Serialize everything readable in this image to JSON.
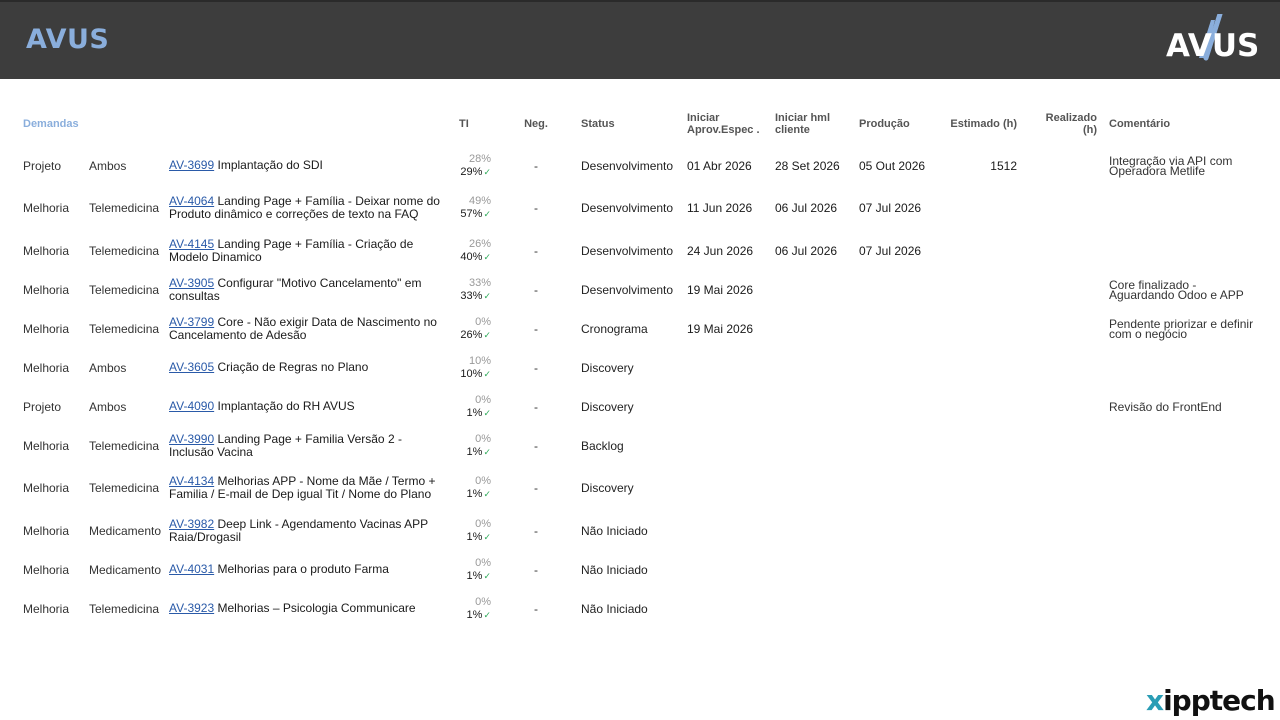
{
  "header": {
    "title": "AVUS",
    "title_color": "#8aaedc",
    "background": "#3d3d3d",
    "logo_text": "AVUS"
  },
  "columns": {
    "demandas": "Demandas",
    "ti": "TI",
    "neg": "Neg.",
    "status": "Status",
    "iniciar_aprov": "Iniciar Aprov.Espec .",
    "iniciar_hml": "Iniciar  hml cliente",
    "producao": "Produção",
    "estimado": "Estimado (h)",
    "realizado": "Realizado (h)",
    "comentario": "Comentário"
  },
  "rows": [
    {
      "tipo": "Projeto",
      "area": "Ambos",
      "code": "AV-3699",
      "title": "Implantação do SDI",
      "ti_est": "28%",
      "ti_real": "29%",
      "neg": "-",
      "status": "Desenvolvimento",
      "aprov": "01 Abr 2026",
      "hml": "28 Set 2026",
      "prod": "05 Out 2026",
      "estimado": "1512",
      "realizado": "",
      "comentario": "Integração via API com Operadora Metlife"
    },
    {
      "tipo": "Melhoria",
      "area": "Telemedicina",
      "code": "AV-4064",
      "title": "Landing Page + Família - Deixar nome do Produto dinâmico e correções de texto na FAQ",
      "ti_est": "49%",
      "ti_real": "57%",
      "neg": "-",
      "status": "Desenvolvimento",
      "aprov": "11 Jun 2026",
      "hml": "06 Jul 2026",
      "prod": "07 Jul 2026",
      "estimado": "",
      "realizado": "",
      "comentario": ""
    },
    {
      "tipo": "Melhoria",
      "area": "Telemedicina",
      "code": "AV-4145",
      "title": "Landing Page + Família - Criação de Modelo Dinamico",
      "ti_est": "26%",
      "ti_real": "40%",
      "neg": "-",
      "status": "Desenvolvimento",
      "aprov": "24 Jun 2026",
      "hml": "06 Jul 2026",
      "prod": "07 Jul 2026",
      "estimado": "",
      "realizado": "",
      "comentario": ""
    },
    {
      "tipo": "Melhoria",
      "area": "Telemedicina",
      "code": "AV-3905",
      "title": "Configurar \"Motivo Cancelamento\" em consultas",
      "ti_est": "33%",
      "ti_real": "33%",
      "neg": "-",
      "status": "Desenvolvimento",
      "aprov": "19 Mai 2026",
      "hml": "",
      "prod": "",
      "estimado": "",
      "realizado": "",
      "comentario": "Core finalizado - Aguardando Odoo e APP"
    },
    {
      "tipo": "Melhoria",
      "area": "Telemedicina",
      "code": "AV-3799",
      "title": "Core - Não exigir Data de Nascimento no Cancelamento de Adesão",
      "ti_est": "0%",
      "ti_real": "26%",
      "neg": "-",
      "status": "Cronograma",
      "aprov": "19 Mai 2026",
      "hml": "",
      "prod": "",
      "estimado": "",
      "realizado": "",
      "comentario": "Pendente priorizar e definir com o negócio"
    },
    {
      "tipo": "Melhoria",
      "area": "Ambos",
      "code": "AV-3605",
      "title": "Criação de Regras no Plano",
      "ti_est": "10%",
      "ti_real": "10%",
      "neg": "-",
      "status": "Discovery",
      "aprov": "",
      "hml": "",
      "prod": "",
      "estimado": "",
      "realizado": "",
      "comentario": ""
    },
    {
      "tipo": "Projeto",
      "area": "Ambos",
      "code": "AV-4090",
      "title": "Implantação do RH AVUS",
      "ti_est": "0%",
      "ti_real": "1%",
      "neg": "-",
      "status": "Discovery",
      "aprov": "",
      "hml": "",
      "prod": "",
      "estimado": "",
      "realizado": "",
      "comentario": "Revisão do FrontEnd"
    },
    {
      "tipo": "Melhoria",
      "area": "Telemedicina",
      "code": "AV-3990",
      "title": "Landing Page + Familia Versão 2 - Inclusão Vacina",
      "ti_est": "0%",
      "ti_real": "1%",
      "neg": "-",
      "status": "Backlog",
      "aprov": "",
      "hml": "",
      "prod": "",
      "estimado": "",
      "realizado": "",
      "comentario": ""
    },
    {
      "tipo": "Melhoria",
      "area": "Telemedicina",
      "code": "AV-4134",
      "title": "Melhorias APP - Nome da Mãe / Termo + Familia / E-mail de Dep igual Tit / Nome do Plano",
      "ti_est": "0%",
      "ti_real": "1%",
      "neg": "-",
      "status": "Discovery",
      "aprov": "",
      "hml": "",
      "prod": "",
      "estimado": "",
      "realizado": "",
      "comentario": ""
    },
    {
      "tipo": "Melhoria",
      "area": "Medicamento",
      "code": "AV-3982",
      "title": "Deep Link - Agendamento Vacinas APP Raia/Drogasil",
      "ti_est": "0%",
      "ti_real": "1%",
      "neg": "-",
      "status": "Não Iniciado",
      "aprov": "",
      "hml": "",
      "prod": "",
      "estimado": "",
      "realizado": "",
      "comentario": ""
    },
    {
      "tipo": "Melhoria",
      "area": "Medicamento",
      "code": "AV-4031",
      "title": "Melhorias para o produto Farma",
      "ti_est": "0%",
      "ti_real": "1%",
      "neg": "-",
      "status": "Não Iniciado",
      "aprov": "",
      "hml": "",
      "prod": "",
      "estimado": "",
      "realizado": "",
      "comentario": ""
    },
    {
      "tipo": "Melhoria",
      "area": "Telemedicina",
      "code": "AV-3923",
      "title": "Melhorias – Psicologia Communicare",
      "ti_est": "0%",
      "ti_real": "1%",
      "neg": "-",
      "status": "Não Iniciado",
      "aprov": "",
      "hml": "",
      "prod": "",
      "estimado": "",
      "realizado": "",
      "comentario": ""
    }
  ],
  "check_mark": "✓",
  "footer": {
    "logo_x": "x",
    "logo_rest": "ipptech"
  },
  "colors": {
    "accent": "#8aaedc",
    "link": "#2a5aa8",
    "check": "#2eaa5a"
  }
}
